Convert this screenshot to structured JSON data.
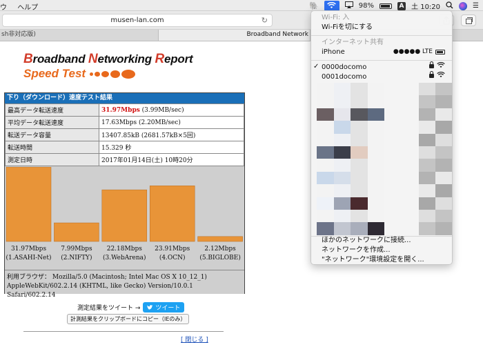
{
  "menubar": {
    "menus": [
      "ウ",
      "ヘルプ"
    ],
    "battery": "98%",
    "input_mode": "A",
    "time": "土 10:20"
  },
  "browser": {
    "url": "musen-lan.com",
    "tabs": [
      "sh非対応版)",
      "Broadband Network"
    ]
  },
  "logo": {
    "line1": [
      {
        "cap": "B",
        "rest": "roadband "
      },
      {
        "cap": "N",
        "rest": "etworking "
      },
      {
        "cap": "R",
        "rest": "eport"
      }
    ],
    "line2": "Speed Test"
  },
  "result": {
    "header": "下り（ダウンロード）速度テスト結果",
    "rows": [
      {
        "label": "最高データ転送速度",
        "value_highlight": "31.97Mbps",
        "value": " (3.99MB/sec)"
      },
      {
        "label": "平均データ転送速度",
        "value_highlight": "",
        "value": "17.63Mbps (2.20MB/sec)"
      },
      {
        "label": "転送データ容量",
        "value_highlight": "",
        "value": "13407.85kB (2681.57kB×5回)"
      },
      {
        "label": "転送時間",
        "value_highlight": "",
        "value": "15.329 秒"
      },
      {
        "label": "測定日時",
        "value_highlight": "",
        "value": "2017年01月14日(土) 10時20分"
      }
    ],
    "browser_info": "利用ブラウザ： Mozilla/5.0 (Macintosh; Intel Mac OS X 10_12_1) AppleWebKit/602.2.14 (KHTML, like Gecko) Version/10.0.1 Safari/602.2.14"
  },
  "chart_data": {
    "type": "bar",
    "categories": [
      "(1.ASAHI-Net)",
      "(2.NIFTY)",
      "(3.WebArena)",
      "(4.OCN)",
      "(5.BIGLOBE)"
    ],
    "value_labels": [
      "31.97Mbps",
      "7.99Mbps",
      "22.18Mbps",
      "23.91Mbps",
      "2.12Mbps"
    ],
    "values": [
      31.97,
      7.99,
      22.18,
      23.91,
      2.12
    ],
    "ylim": [
      0,
      32
    ],
    "bar_color": "#e89438",
    "title": "",
    "xlabel": "",
    "ylabel": ""
  },
  "actions": {
    "tweet_prompt": "測定結果をツイート →",
    "tweet_button": "ツイート",
    "copy_button": "計測結果をクリップボードにコピー（IEのみ）",
    "close_link": "[ 閉じる ]"
  },
  "wifi_menu": {
    "status": "Wi-Fi: 入",
    "toggle": "Wi-Fiを切にする",
    "hotspot_section": "インターネット共有",
    "hotspot_name": "iPhone",
    "hotspot_signal": "●●●●● LTE",
    "networks": [
      {
        "name": "0000docomo",
        "connected": true
      },
      {
        "name": "0001docomo",
        "connected": false
      }
    ],
    "other": "ほかのネットワークに接続...",
    "create": "ネットワークを作成...",
    "prefs": "\"ネットワーク\"環境設定を開く..."
  }
}
